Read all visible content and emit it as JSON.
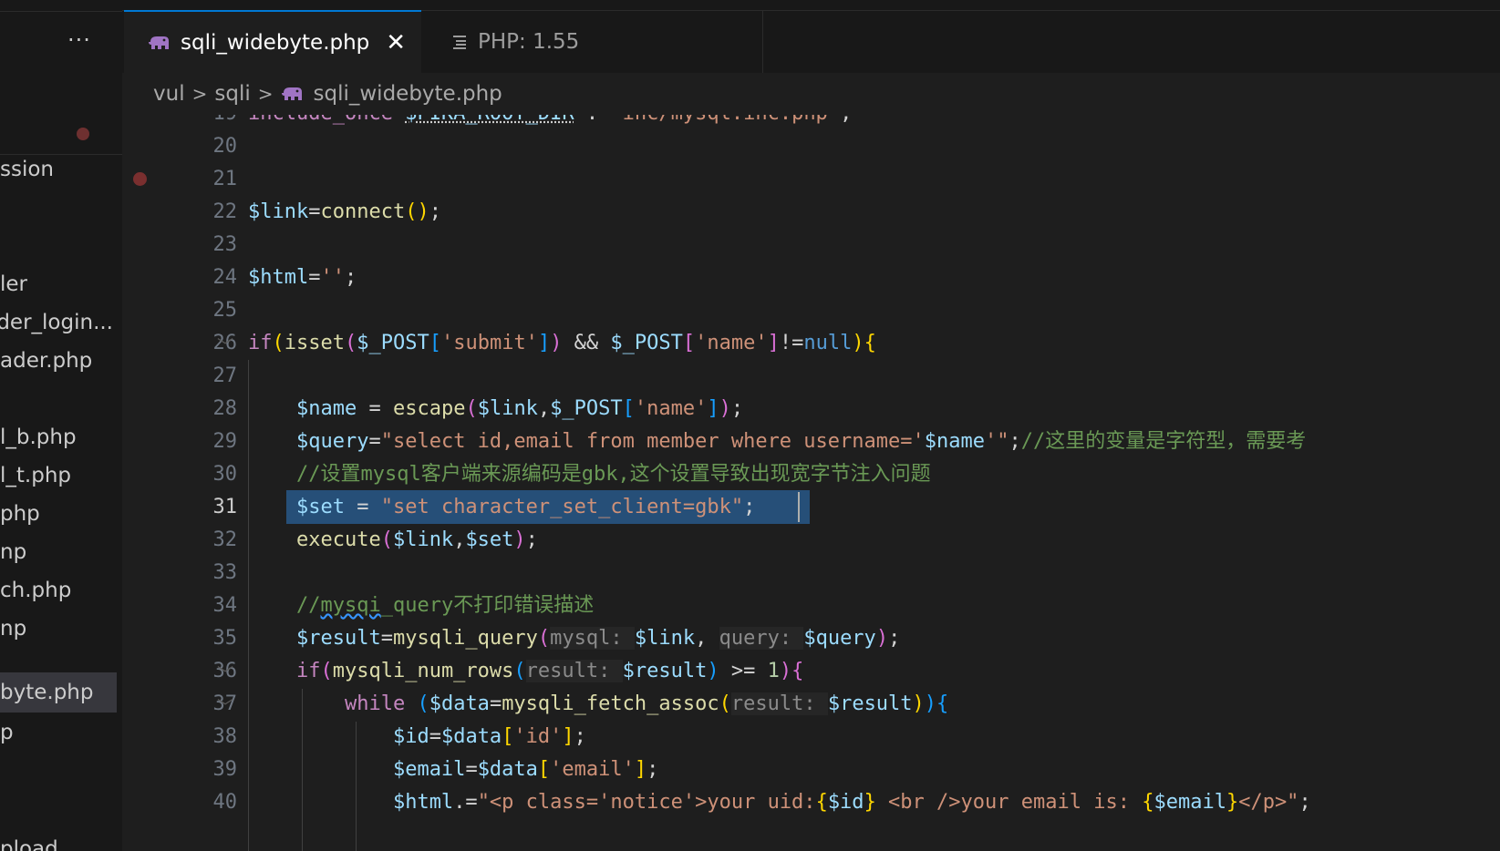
{
  "sidebar": {
    "more_label": "···",
    "items": [
      {
        "label": "ssion"
      },
      {
        "label": "ler"
      },
      {
        "label": "ader_login..."
      },
      {
        "label": "ader.php"
      },
      {
        "label": "l_b.php"
      },
      {
        "label": "l_t.php"
      },
      {
        "label": "php"
      },
      {
        "label": "np"
      },
      {
        "label": "ch.php"
      },
      {
        "label": "np"
      },
      {
        "label": "byte.php"
      },
      {
        "label": "p"
      },
      {
        "label": "pload"
      }
    ]
  },
  "tabs": [
    {
      "label": "sqli_widebyte.php",
      "icon": "php-elephant-icon",
      "close": "✕",
      "active": true
    },
    {
      "label": "PHP: 1.55",
      "icon": "outline-icon",
      "active": false
    }
  ],
  "breadcrumb": [
    "vul",
    "sqli",
    "sqli_widebyte.php"
  ],
  "editor": {
    "current_line": 31,
    "lines": [
      {
        "n": "19",
        "code": "include_once $PIKA_ROOT_DIR . \"inc/mysql.inc.php\";"
      },
      {
        "n": "20",
        "code": ""
      },
      {
        "n": "21",
        "code": "",
        "breakpoint": true
      },
      {
        "n": "22",
        "code": "$link=connect();"
      },
      {
        "n": "23",
        "code": ""
      },
      {
        "n": "24",
        "code": "$html='';"
      },
      {
        "n": "25",
        "code": ""
      },
      {
        "n": "26",
        "code": "if(isset($_POST['submit']) && $_POST['name']!=null){"
      },
      {
        "n": "27",
        "code": ""
      },
      {
        "n": "28",
        "code": "    $name = escape($link,$_POST['name']);"
      },
      {
        "n": "29",
        "code": "    $query=\"select id,email from member where username='$name'\";//这里的变量是字符型，需要考"
      },
      {
        "n": "30",
        "code": "    //设置mysql客户端来源编码是gbk,这个设置导致出现宽字节注入问题"
      },
      {
        "n": "31",
        "code": "    $set = \"set character_set_client=gbk\";"
      },
      {
        "n": "32",
        "code": "    execute($link,$set);"
      },
      {
        "n": "33",
        "code": ""
      },
      {
        "n": "34",
        "code": "    //mysqi_query不打印错误描述"
      },
      {
        "n": "35",
        "code": "    $result=mysqli_query(mysql: $link, query: $query);"
      },
      {
        "n": "36",
        "code": "    if(mysqli_num_rows(result: $result) >= 1){"
      },
      {
        "n": "37",
        "code": "        while ($data=mysqli_fetch_assoc(result: $result)){"
      },
      {
        "n": "38",
        "code": "            $id=$data['id'];"
      },
      {
        "n": "39",
        "code": "            $email=$data['email'];"
      },
      {
        "n": "40",
        "code": "            $html.=\"<p class='notice'>your uid:{$id} <br />your email is: {$email}</p>\";"
      }
    ]
  },
  "colors": {
    "background": "#1e1e1e",
    "tab_accent": "#0078d4",
    "selection": "#264f78",
    "breakpoint": "#7a2f2f"
  }
}
